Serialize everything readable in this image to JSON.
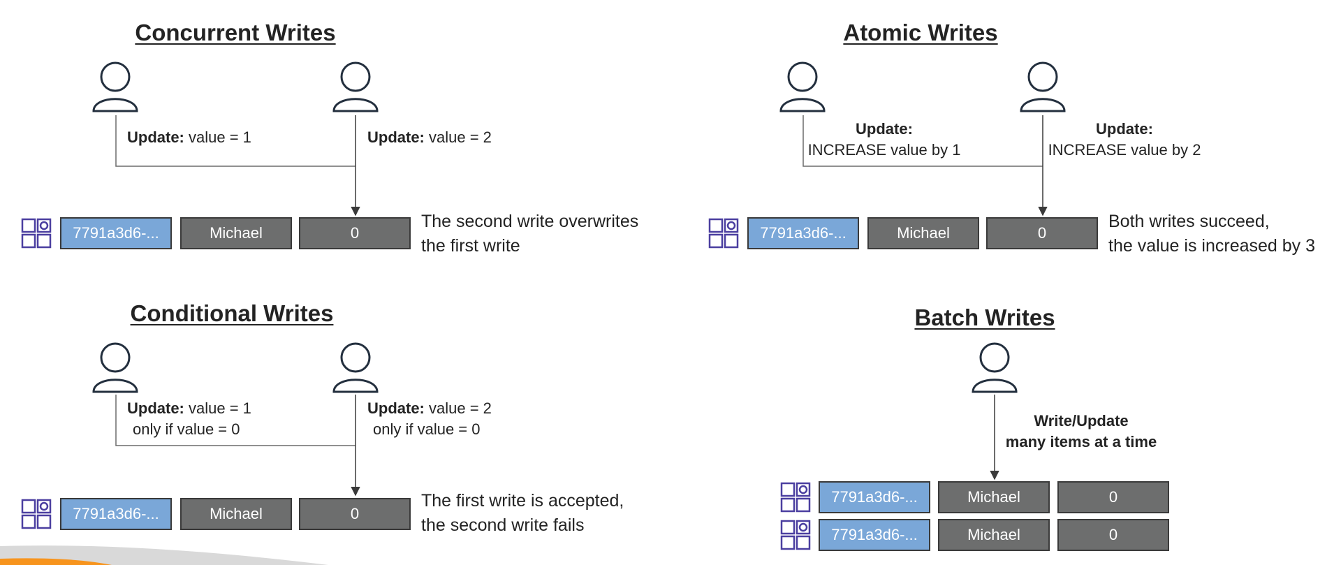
{
  "colors": {
    "key_cell": "#7aa7d8",
    "value_cell": "#6d6e6e",
    "line": "#3a3a3a",
    "icon": "#4b3fa0",
    "person": "#232f3e",
    "accent_bar": "#f7941d"
  },
  "concurrent": {
    "title": "Concurrent Writes",
    "user1": {
      "label_bold": "Update:",
      "label_rest": " value = 1"
    },
    "user2": {
      "label_bold": "Update:",
      "label_rest": " value = 2"
    },
    "row": {
      "id": "7791a3d6-...",
      "name": "Michael",
      "value": "0"
    },
    "desc_line1": "The second write overwrites",
    "desc_line2": "the first write"
  },
  "atomic": {
    "title": "Atomic Writes",
    "user1": {
      "label_bold": "Update:",
      "label_line2": "INCREASE value by 1"
    },
    "user2": {
      "label_bold": "Update:",
      "label_line2": "INCREASE value by 2"
    },
    "row": {
      "id": "7791a3d6-...",
      "name": "Michael",
      "value": "0"
    },
    "desc_line1": "Both writes succeed,",
    "desc_line2": "the value is increased by 3"
  },
  "conditional": {
    "title": "Conditional Writes",
    "user1": {
      "label_bold": "Update:",
      "label_rest": " value = 1",
      "label_line2": "only if value = 0"
    },
    "user2": {
      "label_bold": "Update:",
      "label_rest": " value = 2",
      "label_line2": "only if value = 0"
    },
    "row": {
      "id": "7791a3d6-...",
      "name": "Michael",
      "value": "0"
    },
    "desc_line1": "The first write is accepted,",
    "desc_line2": "the second write fails"
  },
  "batch": {
    "title": "Batch Writes",
    "label_line1": "Write/Update",
    "label_line2": "many items at a time",
    "rows": [
      {
        "id": "7791a3d6-...",
        "name": "Michael",
        "value": "0"
      },
      {
        "id": "7791a3d6-...",
        "name": "Michael",
        "value": "0"
      }
    ]
  }
}
